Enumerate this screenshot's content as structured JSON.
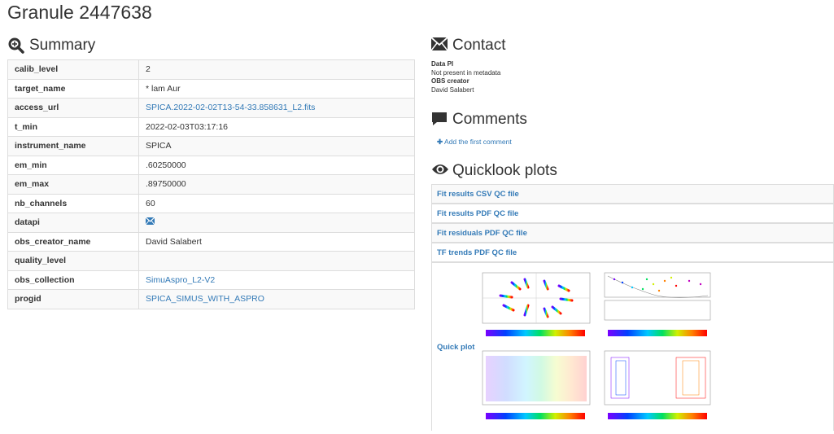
{
  "title": "Granule 2447638",
  "summary": {
    "heading": "Summary",
    "rows": [
      {
        "key": "calib_level",
        "value": "2"
      },
      {
        "key": "target_name",
        "value": "* lam Aur"
      },
      {
        "key": "access_url",
        "value": "SPICA.2022-02-02T13-54-33.858631_L2.fits"
      },
      {
        "key": "t_min",
        "value": "2022-02-03T03:17:16"
      },
      {
        "key": "instrument_name",
        "value": "SPICA"
      },
      {
        "key": "em_min",
        "value": ".60250000"
      },
      {
        "key": "em_max",
        "value": ".89750000"
      },
      {
        "key": "nb_channels",
        "value": "60"
      },
      {
        "key": "datapi",
        "value": ""
      },
      {
        "key": "obs_creator_name",
        "value": "David Salabert"
      },
      {
        "key": "quality_level",
        "value": ""
      },
      {
        "key": "obs_collection",
        "value": "SimuAspro_L2-V2"
      },
      {
        "key": "progid",
        "value": "SPICA_SIMUS_WITH_ASPRO"
      }
    ]
  },
  "contact": {
    "heading": "Contact",
    "data_pi_label": "Data PI",
    "data_pi_value": "Not present in metadata",
    "obs_creator_label": "OBS creator",
    "obs_creator_value": "David Salabert"
  },
  "comments": {
    "heading": "Comments",
    "add_link": "Add the first comment"
  },
  "quicklook": {
    "heading": "Quicklook plots",
    "links": [
      "Fit results CSV QC file",
      "Fit results PDF QC file",
      "Fit residuals PDF QC file",
      "TF trends PDF QC file"
    ],
    "quick_plot_label": "Quick plot"
  },
  "colors": {
    "link": "#337ab7",
    "border": "#dddddd",
    "stripe": "#f9f9f9"
  }
}
